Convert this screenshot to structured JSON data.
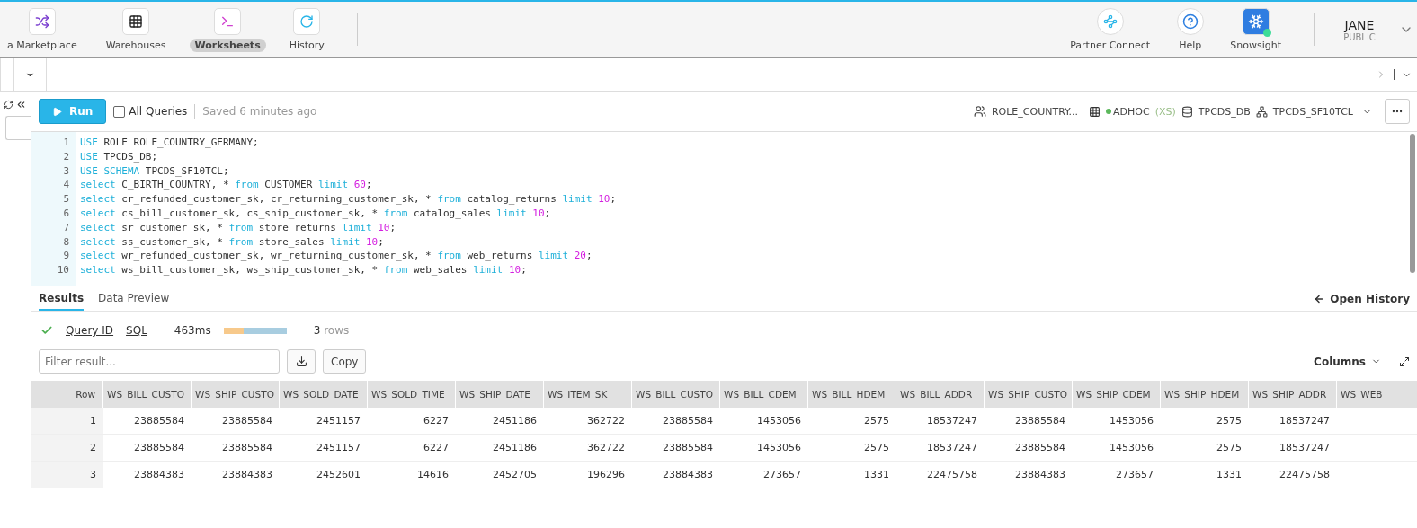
{
  "nav": {
    "items": [
      {
        "label": "a Marketplace",
        "selected": false
      },
      {
        "label": "Warehouses",
        "selected": false
      },
      {
        "label": "Worksheets",
        "selected": true
      },
      {
        "label": "History",
        "selected": false
      }
    ],
    "right": [
      {
        "label": "Partner Connect"
      },
      {
        "label": "Help"
      },
      {
        "label": "Snowsight"
      }
    ],
    "user": {
      "name": "JANE",
      "role": "PUBLIC"
    }
  },
  "worksheet_tab": {
    "label": "-"
  },
  "toolbar": {
    "run": "Run",
    "all_queries": {
      "label": "All Queries",
      "checked": false
    },
    "saved": "Saved 6 minutes ago",
    "context": {
      "role": "ROLE_COUNTRY...",
      "warehouse": "ADHOC",
      "size": "(XS)",
      "database": "TPCDS_DB",
      "schema": "TPCDS_SF10TCL"
    }
  },
  "editor": {
    "lines": [
      {
        "number": "1",
        "tokens": [
          {
            "kind": "keyword",
            "text": "USE"
          },
          {
            "kind": "ident",
            "text": " ROLE ROLE_COUNTRY_GERMANY;"
          }
        ]
      },
      {
        "number": "2",
        "tokens": [
          {
            "kind": "keyword",
            "text": "USE"
          },
          {
            "kind": "ident",
            "text": " TPCDS_DB;"
          }
        ]
      },
      {
        "number": "3",
        "tokens": [
          {
            "kind": "keyword",
            "text": "USE SCHEMA"
          },
          {
            "kind": "ident",
            "text": " TPCDS_SF10TCL;"
          }
        ]
      },
      {
        "number": "4",
        "tokens": [
          {
            "kind": "keyword",
            "text": "select"
          },
          {
            "kind": "ident",
            "text": " C_BIRTH_COUNTRY, * "
          },
          {
            "kind": "keyword",
            "text": "from"
          },
          {
            "kind": "ident",
            "text": " CUSTOMER "
          },
          {
            "kind": "keyword",
            "text": "limit "
          },
          {
            "kind": "number",
            "text": "60"
          },
          {
            "kind": "ident",
            "text": ";"
          }
        ]
      },
      {
        "number": "5",
        "tokens": [
          {
            "kind": "keyword",
            "text": "select"
          },
          {
            "kind": "ident",
            "text": " cr_refunded_customer_sk, cr_returning_customer_sk, * "
          },
          {
            "kind": "keyword",
            "text": "from"
          },
          {
            "kind": "ident",
            "text": " catalog_returns "
          },
          {
            "kind": "keyword",
            "text": "limit "
          },
          {
            "kind": "number",
            "text": "10"
          },
          {
            "kind": "ident",
            "text": ";"
          }
        ]
      },
      {
        "number": "6",
        "tokens": [
          {
            "kind": "keyword",
            "text": "select"
          },
          {
            "kind": "ident",
            "text": " cs_bill_customer_sk, cs_ship_customer_sk, * "
          },
          {
            "kind": "keyword",
            "text": "from"
          },
          {
            "kind": "ident",
            "text": " catalog_sales "
          },
          {
            "kind": "keyword",
            "text": "limit "
          },
          {
            "kind": "number",
            "text": "10"
          },
          {
            "kind": "ident",
            "text": ";"
          }
        ]
      },
      {
        "number": "7",
        "tokens": [
          {
            "kind": "keyword",
            "text": "select"
          },
          {
            "kind": "ident",
            "text": " sr_customer_sk, * "
          },
          {
            "kind": "keyword",
            "text": "from"
          },
          {
            "kind": "ident",
            "text": " store_returns "
          },
          {
            "kind": "keyword",
            "text": "limit "
          },
          {
            "kind": "number",
            "text": "10"
          },
          {
            "kind": "ident",
            "text": ";"
          }
        ]
      },
      {
        "number": "8",
        "tokens": [
          {
            "kind": "keyword",
            "text": "select"
          },
          {
            "kind": "ident",
            "text": " ss_customer_sk, * "
          },
          {
            "kind": "keyword",
            "text": "from"
          },
          {
            "kind": "ident",
            "text": " store_sales "
          },
          {
            "kind": "keyword",
            "text": "limit "
          },
          {
            "kind": "number",
            "text": "10"
          },
          {
            "kind": "ident",
            "text": ";"
          }
        ]
      },
      {
        "number": "9",
        "tokens": [
          {
            "kind": "keyword",
            "text": "select"
          },
          {
            "kind": "ident",
            "text": " wr_refunded_customer_sk, wr_returning_customer_sk, * "
          },
          {
            "kind": "keyword",
            "text": "from"
          },
          {
            "kind": "ident",
            "text": " web_returns "
          },
          {
            "kind": "keyword",
            "text": "limit "
          },
          {
            "kind": "number",
            "text": "20"
          },
          {
            "kind": "ident",
            "text": ";"
          }
        ]
      },
      {
        "number": "10",
        "tokens": [
          {
            "kind": "keyword",
            "text": "select"
          },
          {
            "kind": "ident",
            "text": " ws_bill_customer_sk, ws_ship_customer_sk, * "
          },
          {
            "kind": "keyword",
            "text": "from"
          },
          {
            "kind": "ident",
            "text": " web_sales "
          },
          {
            "kind": "keyword",
            "text": "limit "
          },
          {
            "kind": "number",
            "text": "10"
          },
          {
            "kind": "ident",
            "text": ";"
          }
        ]
      }
    ]
  },
  "results": {
    "tabs": [
      {
        "label": "Results",
        "selected": true
      },
      {
        "label": "Data Preview",
        "selected": false
      }
    ],
    "open_history": "Open History",
    "status": {
      "query_id": "Query ID",
      "sql": "SQL",
      "duration": "463ms",
      "level": 0.32,
      "rows_count": "3",
      "rows_label": "rows"
    },
    "filter": {
      "placeholder": "Filter result..."
    },
    "copy": "Copy",
    "columns": "Columns"
  },
  "table": {
    "columns": [
      "Row",
      "WS_BILL_CUSTO",
      "WS_SHIP_CUSTO",
      "WS_SOLD_DATE",
      "WS_SOLD_TIME",
      "WS_SHIP_DATE_",
      "WS_ITEM_SK",
      "WS_BILL_CUSTO",
      "WS_BILL_CDEM",
      "WS_BILL_HDEM",
      "WS_BILL_ADDR_",
      "WS_SHIP_CUSTO",
      "WS_SHIP_CDEM",
      "WS_SHIP_HDEM",
      "WS_SHIP_ADDR",
      "WS_WEB"
    ],
    "rows": [
      [
        "1",
        "23885584",
        "23885584",
        "2451157",
        "6227",
        "2451186",
        "362722",
        "23885584",
        "1453056",
        "2575",
        "18537247",
        "23885584",
        "1453056",
        "2575",
        "18537247"
      ],
      [
        "2",
        "23885584",
        "23885584",
        "2451157",
        "6227",
        "2451186",
        "362722",
        "23885584",
        "1453056",
        "2575",
        "18537247",
        "23885584",
        "1453056",
        "2575",
        "18537247"
      ],
      [
        "3",
        "23884383",
        "23884383",
        "2452601",
        "14616",
        "2452705",
        "196296",
        "23884383",
        "273657",
        "1331",
        "22475758",
        "23884383",
        "273657",
        "1331",
        "22475758"
      ]
    ]
  }
}
